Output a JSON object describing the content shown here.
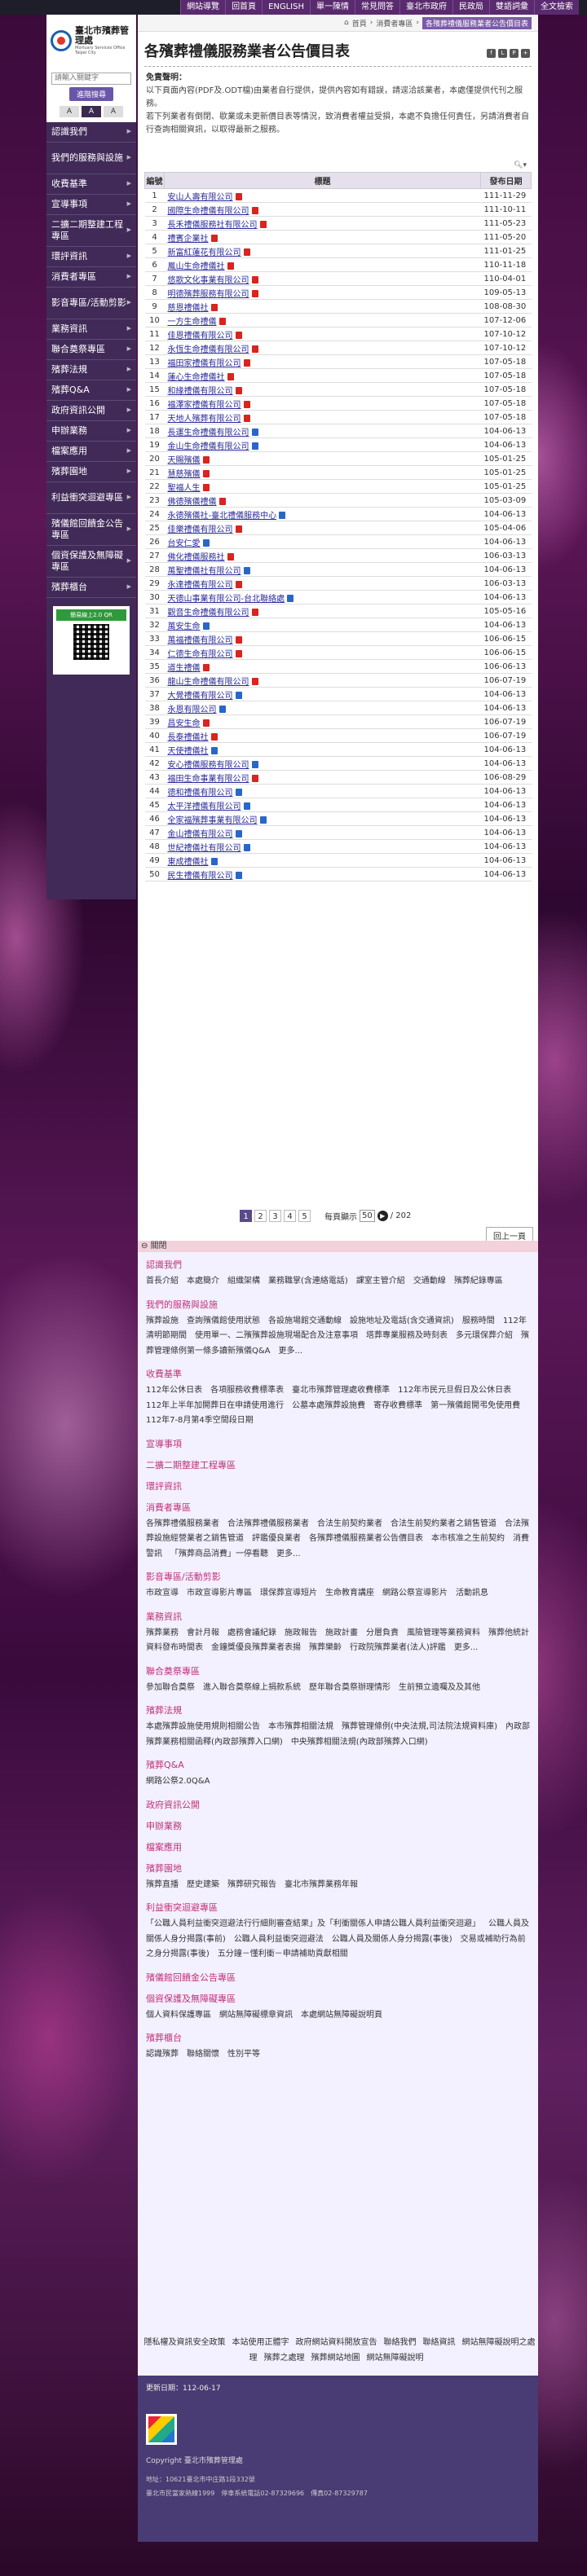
{
  "top_links": [
    "網站導覽",
    "回首頁",
    "ENGLISH",
    "單一陳情",
    "常見問答",
    "臺北市政府",
    "民政局",
    "雙語詞彙",
    "全文檢索"
  ],
  "site": {
    "name_zh": "臺北市殯葬管理處",
    "name_en": "Mortuary Services Office Taipei City"
  },
  "search": {
    "placeholder": "請輸入關鍵字",
    "button": "進階搜尋"
  },
  "font_sizes": [
    "A",
    "A",
    "A"
  ],
  "menu": [
    {
      "label": "認識我們",
      "h": 1
    },
    {
      "label": "我們的服務與設施",
      "h": 2
    },
    {
      "label": "收費基準",
      "h": 1
    },
    {
      "label": "宣導事項",
      "h": 1
    },
    {
      "label": "二擴二期整建工程專區",
      "h": 2
    },
    {
      "label": "環評資訊",
      "h": 1
    },
    {
      "label": "消費者專區",
      "h": 1
    },
    {
      "label": "影音專區/活動剪影",
      "h": 2
    },
    {
      "label": "業務資訊",
      "h": 1
    },
    {
      "label": "聯合奠祭專區",
      "h": 1
    },
    {
      "label": "殯葬法規",
      "h": 1
    },
    {
      "label": "殯葬Q&A",
      "h": 1
    },
    {
      "label": "政府資訊公開",
      "h": 1
    },
    {
      "label": "申辦業務",
      "h": 1
    },
    {
      "label": "檔案應用",
      "h": 1
    },
    {
      "label": "殯葬園地",
      "h": 1
    },
    {
      "label": "利益衝突迴避專區",
      "h": 2
    },
    {
      "label": "殯儀館回饋金公告專區",
      "h": 2
    },
    {
      "label": "個資保護及無障礙專區",
      "h": 2
    },
    {
      "label": "殯葬櫃台",
      "h": 1
    }
  ],
  "qr_label": "簡易線上2.0 QR",
  "breadcrumb": {
    "home": "首頁",
    "parent": "消費者專區",
    "current": "各殯葬禮儀服務業者公告價目表"
  },
  "page_title": "各殯葬禮儀服務業者公告價目表",
  "notice": {
    "title": "免責聲明：",
    "lines": [
      "以下頁面內容(PDF及.ODT檔)由業者自行提供，提供內容如有錯誤，請逕洽該業者，本處僅提供代刊之服務。",
      "若下列業者有倒閉、歇業或未更新價目表等情況，致消費者權益受損，本處不負擔任何責任，另請消費者自行查詢相關資訊，以取得最新之服務。"
    ]
  },
  "table": {
    "headers": [
      "編號",
      "標題",
      "發布日期"
    ],
    "rows": [
      [
        "1",
        "安山人壽有限公司",
        "111-11-29",
        "pdf"
      ],
      [
        "2",
        "國際生命禮儀有限公司",
        "111-10-11",
        "pdf"
      ],
      [
        "3",
        "長禾禮儀服務社有限公司",
        "111-05-23",
        "pdf"
      ],
      [
        "4",
        "禮賓企業社",
        "111-05-20",
        "pdf"
      ],
      [
        "5",
        "新富紅蓮花有限公司",
        "111-01-25",
        "pdf"
      ],
      [
        "6",
        "鳳山生命禮儀社",
        "110-11-18",
        "pdf"
      ],
      [
        "7",
        "悠歌文化事業有限公司",
        "110-04-01",
        "pdf"
      ],
      [
        "8",
        "明德殯葬服務有限公司",
        "109-05-13",
        "pdf"
      ],
      [
        "9",
        "慈恩禮儀社",
        "108-08-30",
        "pdf"
      ],
      [
        "10",
        "一方生命禮儀",
        "107-12-06",
        "pdf"
      ],
      [
        "11",
        "佳恩禮儀有限公司",
        "107-10-12",
        "pdf"
      ],
      [
        "12",
        "永恆生命禮儀有限公司",
        "107-10-12",
        "pdf"
      ],
      [
        "13",
        "福田家禮儀有限公司",
        "107-05-18",
        "pdf"
      ],
      [
        "14",
        "蓮心生命禮儀社",
        "107-05-18",
        "pdf"
      ],
      [
        "15",
        "和緣禮儀有限公司",
        "107-05-18",
        "pdf"
      ],
      [
        "16",
        "福澤家禮儀有限公司",
        "107-05-18",
        "pdf"
      ],
      [
        "17",
        "天地人殯葬有限公司",
        "107-05-18",
        "pdf"
      ],
      [
        "18",
        "長運生命禮儀有限公司",
        "104-06-13",
        "odf"
      ],
      [
        "19",
        "金山生命禮儀有限公司",
        "104-06-13",
        "odf"
      ],
      [
        "20",
        "天賜殯儀",
        "105-01-25",
        "pdf"
      ],
      [
        "21",
        "慧慈殯儀",
        "105-01-25",
        "pdf"
      ],
      [
        "22",
        "聖福人生",
        "105-01-25",
        "pdf"
      ],
      [
        "23",
        "佛德殯儀禮儀",
        "105-03-09",
        "pdf"
      ],
      [
        "24",
        "永德殯儀社-臺北禮儀服務中心",
        "104-06-13",
        "odf"
      ],
      [
        "25",
        "佳樂禮儀有限公司",
        "105-04-06",
        "pdf"
      ],
      [
        "26",
        "台安仁愛",
        "104-06-13",
        "odf"
      ],
      [
        "27",
        "佛化禮儀服務社",
        "106-03-13",
        "pdf"
      ],
      [
        "28",
        "萬聖禮儀社有限公司",
        "104-06-13",
        "odf"
      ],
      [
        "29",
        "永達禮儀有限公司",
        "106-03-13",
        "pdf"
      ],
      [
        "30",
        "天德山事業有限公司-台北聯絡處",
        "104-06-13",
        "odf"
      ],
      [
        "31",
        "觀音生命禮儀有限公司",
        "105-05-16",
        "pdf"
      ],
      [
        "32",
        "萬安生命",
        "104-06-13",
        "odf"
      ],
      [
        "33",
        "萬福禮儀有限公司",
        "106-06-15",
        "pdf"
      ],
      [
        "34",
        "仁德生命有限公司",
        "106-06-15",
        "pdf"
      ],
      [
        "35",
        "道生禮儀",
        "106-06-13",
        "pdf"
      ],
      [
        "36",
        "龍山生命禮儀有限公司",
        "106-07-19",
        "pdf"
      ],
      [
        "37",
        "大覺禮儀有限公司",
        "104-06-13",
        "odf"
      ],
      [
        "38",
        "永恩有限公司",
        "104-06-13",
        "odf"
      ],
      [
        "39",
        "昌安生命",
        "106-07-19",
        "pdf"
      ],
      [
        "40",
        "長泰禮儀社",
        "106-07-19",
        "pdf"
      ],
      [
        "41",
        "天使禮儀社",
        "104-06-13",
        "odf"
      ],
      [
        "42",
        "安心禮儀服務有限公司",
        "104-06-13",
        "odf"
      ],
      [
        "43",
        "福田生命事業有限公司",
        "106-08-29",
        "pdf"
      ],
      [
        "44",
        "德和禮儀有限公司",
        "104-06-13",
        "odf"
      ],
      [
        "45",
        "太平洋禮儀有限公司",
        "104-06-13",
        "odf"
      ],
      [
        "46",
        "全家福殯葬事業有限公司",
        "104-06-13",
        "odf"
      ],
      [
        "47",
        "金山禮儀有限公司",
        "104-06-13",
        "odf"
      ],
      [
        "48",
        "世紀禮儀社有限公司",
        "104-06-13",
        "odf"
      ],
      [
        "49",
        "東成禮儀社",
        "104-06-13",
        "odf"
      ],
      [
        "50",
        "民生禮儀有限公司",
        "104-06-13",
        "odf"
      ]
    ]
  },
  "pager": {
    "pages": [
      "1",
      "2",
      "3",
      "4",
      "5"
    ],
    "per_page_label": "每頁顯示",
    "per_page": "50",
    "total": "/ 202",
    "back_top": "回上一頁"
  },
  "fatfoot_toggle": "關閉",
  "sitemap": [
    {
      "title": "認識我們",
      "items": [
        "首長介紹",
        "本處簡介",
        "組織架構",
        "業務職掌(含連絡電話)",
        "課室主管介紹",
        "交通動線",
        "殯葬紀錄專區"
      ]
    },
    {
      "title": "我們的服務與設施",
      "items": [
        "殯葬設施",
        "查詢殯儀館使用狀態",
        "各設施場館交通動線",
        "設施地址及電話(含交通資訊)",
        "服務時間",
        "112年清明節期間",
        "使用單一、二殯殯葬設施現場配合及注意事項",
        "塔葬專業服務及時刻表",
        "多元環保葬介紹",
        "殯葬管理條例第一條多讀新殯儀Q&A",
        "更多..."
      ]
    },
    {
      "title": "收費基準",
      "items": [
        "112年公休日表",
        "各項服務收費標準表",
        "臺北市殯葬管理處收費標準",
        "112年市民元旦假日及公休日表",
        "112年上半年加開葬日在申請使用進行",
        "公墓本處殯葬設施費",
        "寄存收費標準",
        "第一殯儀館開弔免使用費",
        "112年7-8月第4季空間段日期"
      ]
    },
    {
      "title": "宣導事項",
      "items": []
    },
    {
      "title": "二擴二期整建工程專區",
      "items": []
    },
    {
      "title": "環評資訊",
      "items": []
    },
    {
      "title": "消費者專區",
      "items": [
        "各殯葬禮儀服務業者",
        "合法殯葬禮儀服務業者",
        "合法生前契約業者",
        "合法生前契約業者之銷售管道",
        "合法殯葬設施經營業者之銷售管道",
        "評鑑優良業者",
        "各殯葬禮儀服務業者公告價目表",
        "本市核准之生前契約",
        "消費警訊",
        "「殯葬商品消費」一停看聽",
        "更多..."
      ]
    },
    {
      "title": "影音專區/活動剪影",
      "items": [
        "市政宣導",
        "市政宣導影片專區",
        "環保葬宣導短片",
        "生命教育講座",
        "網路公祭宣導影片",
        "活動訊息"
      ]
    },
    {
      "title": "業務資訊",
      "items": [
        "殯葬業務",
        "會計月報",
        "處務會議紀錄",
        "施政報告",
        "施政計畫",
        "分層負責",
        "風險管理等業務資料",
        "殯葬他統計資料發布時間表",
        "金鐘獎優良殯葬業者表揚",
        "殯葬樂齡",
        "行政院殯葬業者(法人)評鑑",
        "更多..."
      ]
    },
    {
      "title": "聯合奠祭專區",
      "items": [
        "參加聯合奠祭",
        "進入聯合奠祭線上捐款系統",
        "歷年聯合奠祭辦理情形",
        "生前預立遺囑及及其他"
      ]
    },
    {
      "title": "殯葬法規",
      "items": [
        "本處殯葬設施使用規則相關公告",
        "本市殯葬相關法規",
        "殯葬管理條例(中央法規,司法院法規資料庫)",
        "內政部殯葬業務相關函釋(內政部殯葬入口網)",
        "中央殯葬相關法規(內政部殯葬入口網)"
      ]
    },
    {
      "title": "殯葬Q&A",
      "items": [
        "網路公祭2.0Q&A"
      ]
    },
    {
      "title": "政府資訊公開",
      "items": []
    },
    {
      "title": "申辦業務",
      "items": []
    },
    {
      "title": "檔案應用",
      "items": []
    },
    {
      "title": "殯葬園地",
      "items": [
        "殯葬直播",
        "歷史建築",
        "殯葬研究報告",
        "臺北市殯葬業務年報"
      ]
    },
    {
      "title": "利益衝突迴避專區",
      "items": [
        "「公職人員利益衝突迴避法行行細則審查結果」及「利衝關係人申請公職人員利益衝突迴避」",
        "公職人員及關係人身分揭露(事前)",
        "公職人員利益衝突迴避法",
        "公職人員及關係人身分揭露(事後)",
        "交易或補助行為前之身分揭露(事後)",
        "五分鐘－懂利衝－申請補助貢獻相關"
      ]
    },
    {
      "title": "殯儀館回饋金公告專區",
      "items": []
    },
    {
      "title": "個資保護及無障礙專區",
      "items": [
        "個人資料保護專區",
        "網站無障礙標章資訊",
        "本處網站無障礙說明頁"
      ]
    },
    {
      "title": "殯葬櫃台",
      "items": [
        "認識殯葬",
        "聯絡關懷",
        "性別平等"
      ]
    }
  ],
  "sitemap_bottom": [
    "隱私權及資訊安全政策",
    "本站使用正體字",
    "政府網站資料開放宣告",
    "聯絡我們",
    "聯絡資訊",
    "網站無障礙說明之處理",
    "殯葬之處理",
    "殯葬網站地圖",
    "網站無障礙說明"
  ],
  "footer": {
    "updated": "更新日期：112-06-17",
    "copyright": "Copyright 臺北市殯葬管理處",
    "address": "地址：10621臺北市中庄路1段332號",
    "phone": "臺北市民當家熱線1999　停車系統電話02-87329696　傳真02-87329787"
  }
}
